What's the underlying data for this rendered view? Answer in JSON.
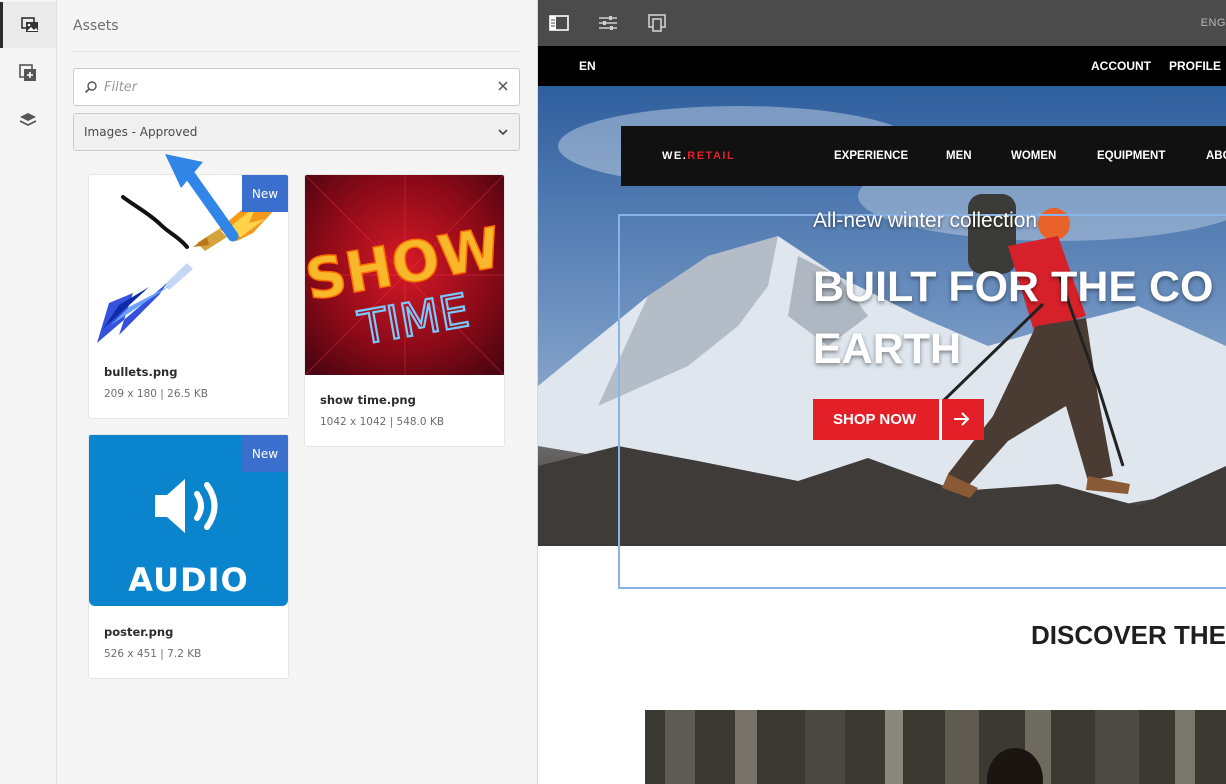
{
  "rail": {
    "items": [
      {
        "icon": "assets-icon",
        "active": true
      },
      {
        "icon": "components-icon",
        "active": false
      },
      {
        "icon": "layers-icon",
        "active": false
      }
    ]
  },
  "panel": {
    "title": "Assets",
    "filter": {
      "placeholder": "Filter",
      "value": ""
    },
    "asset_type": "Images - Approved",
    "assets": [
      {
        "name": "bullets.png",
        "meta": "209 x 180 | 26.5 KB",
        "badge": "New"
      },
      {
        "name": "show time.png",
        "meta": "1042 x 1042 | 548.0 KB",
        "badge": "",
        "art_line1": "SHOW",
        "art_line2": "TIME"
      },
      {
        "name": "poster.png",
        "meta": "526 x 451 | 7.2 KB",
        "badge": "New",
        "art_label": "AUDIO"
      }
    ]
  },
  "toolbar": {
    "buttons": [
      "side-panel-icon",
      "properties-icon",
      "emulator-icon"
    ],
    "language": "ENG"
  },
  "site": {
    "topbar": {
      "lang": "EN",
      "account": "ACCOUNT",
      "profile": "PROFILE"
    },
    "nav": {
      "logo_part1": "WE.",
      "logo_part2": "RETAIL",
      "items": [
        "EXPERIENCE",
        "MEN",
        "WOMEN",
        "EQUIPMENT",
        "ABO"
      ]
    },
    "hero": {
      "kicker": "All-new winter collection",
      "headline": "BUILT FOR THE CO EARTH",
      "cta": "SHOP NOW"
    },
    "discover": "DISCOVER THE"
  },
  "colors": {
    "accent": "#e32027",
    "badge": "#3b6fce",
    "toolbar": "#4b4b4b",
    "selection": "#8ab4e8",
    "annotation_arrow": "#2f86e6"
  }
}
